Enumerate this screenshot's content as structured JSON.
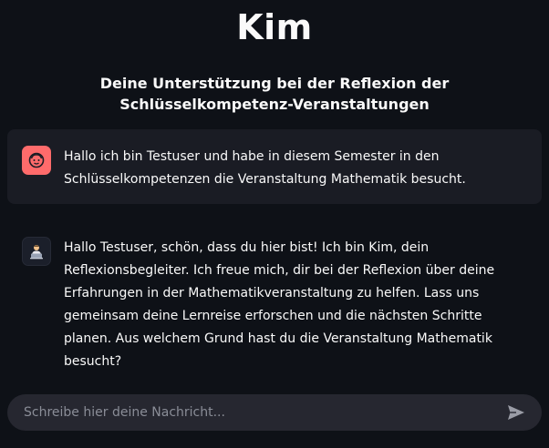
{
  "header": {
    "title": "Kim",
    "subtitle": "Deine Unterstützung bei der Reflexion der Schlüsselkompetenz-Veranstaltungen"
  },
  "chat": {
    "messages": [
      {
        "role": "user",
        "avatar_icon": "face-icon",
        "text": "Hallo ich bin Testuser und habe in diesem Semester in den Schlüsselkompetenzen die Veranstaltung Mathematik besucht."
      },
      {
        "role": "assistant",
        "avatar_icon": "person-at-laptop-icon",
        "text": "Hallo Testuser, schön, dass du hier bist! Ich bin Kim, dein Reflexionsbegleiter. Ich freue mich, dir bei der Reflexion über deine Erfahrungen in der Mathematikveranstaltung zu helfen. Lass uns gemeinsam deine Lernreise erforschen und die nächsten Schritte planen. Aus welchem Grund hast du die Veranstaltung Mathematik besucht?"
      }
    ]
  },
  "input": {
    "placeholder": "Schreibe hier deine Nachricht...",
    "send_icon": "send-icon"
  },
  "colors": {
    "background": "#0e1117",
    "user_message_bg": "#1a1c24",
    "user_avatar": "#ff6b6b",
    "input_bg": "#262730"
  }
}
